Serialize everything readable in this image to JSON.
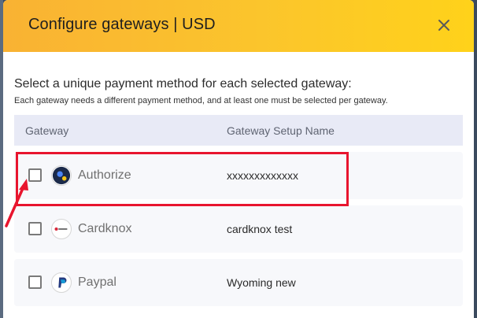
{
  "modal": {
    "title": "Configure gateways | USD",
    "close_icon": "close-icon",
    "instruction": "Select a unique payment method for each selected gateway:",
    "sub_instruction": "Each gateway needs a different payment method, and at least one must be selected per gateway."
  },
  "table": {
    "columns": [
      "Gateway",
      "Gateway Setup Name"
    ],
    "rows": [
      {
        "gateway": "Authorize",
        "setup_name": "xxxxxxxxxxxxx",
        "icon": "authorize-logo",
        "checked": false
      },
      {
        "gateway": "Cardknox",
        "setup_name": "cardknox test",
        "icon": "cardknox-logo",
        "checked": false
      },
      {
        "gateway": "Paypal",
        "setup_name": "Wyoming new",
        "icon": "paypal-logo",
        "checked": false
      }
    ]
  },
  "annotation": {
    "color": "#e8152e"
  },
  "colors": {
    "header_gradient_start": "#f9b233",
    "header_gradient_end": "#ffd21a",
    "table_header_bg": "#e8eaf6"
  }
}
